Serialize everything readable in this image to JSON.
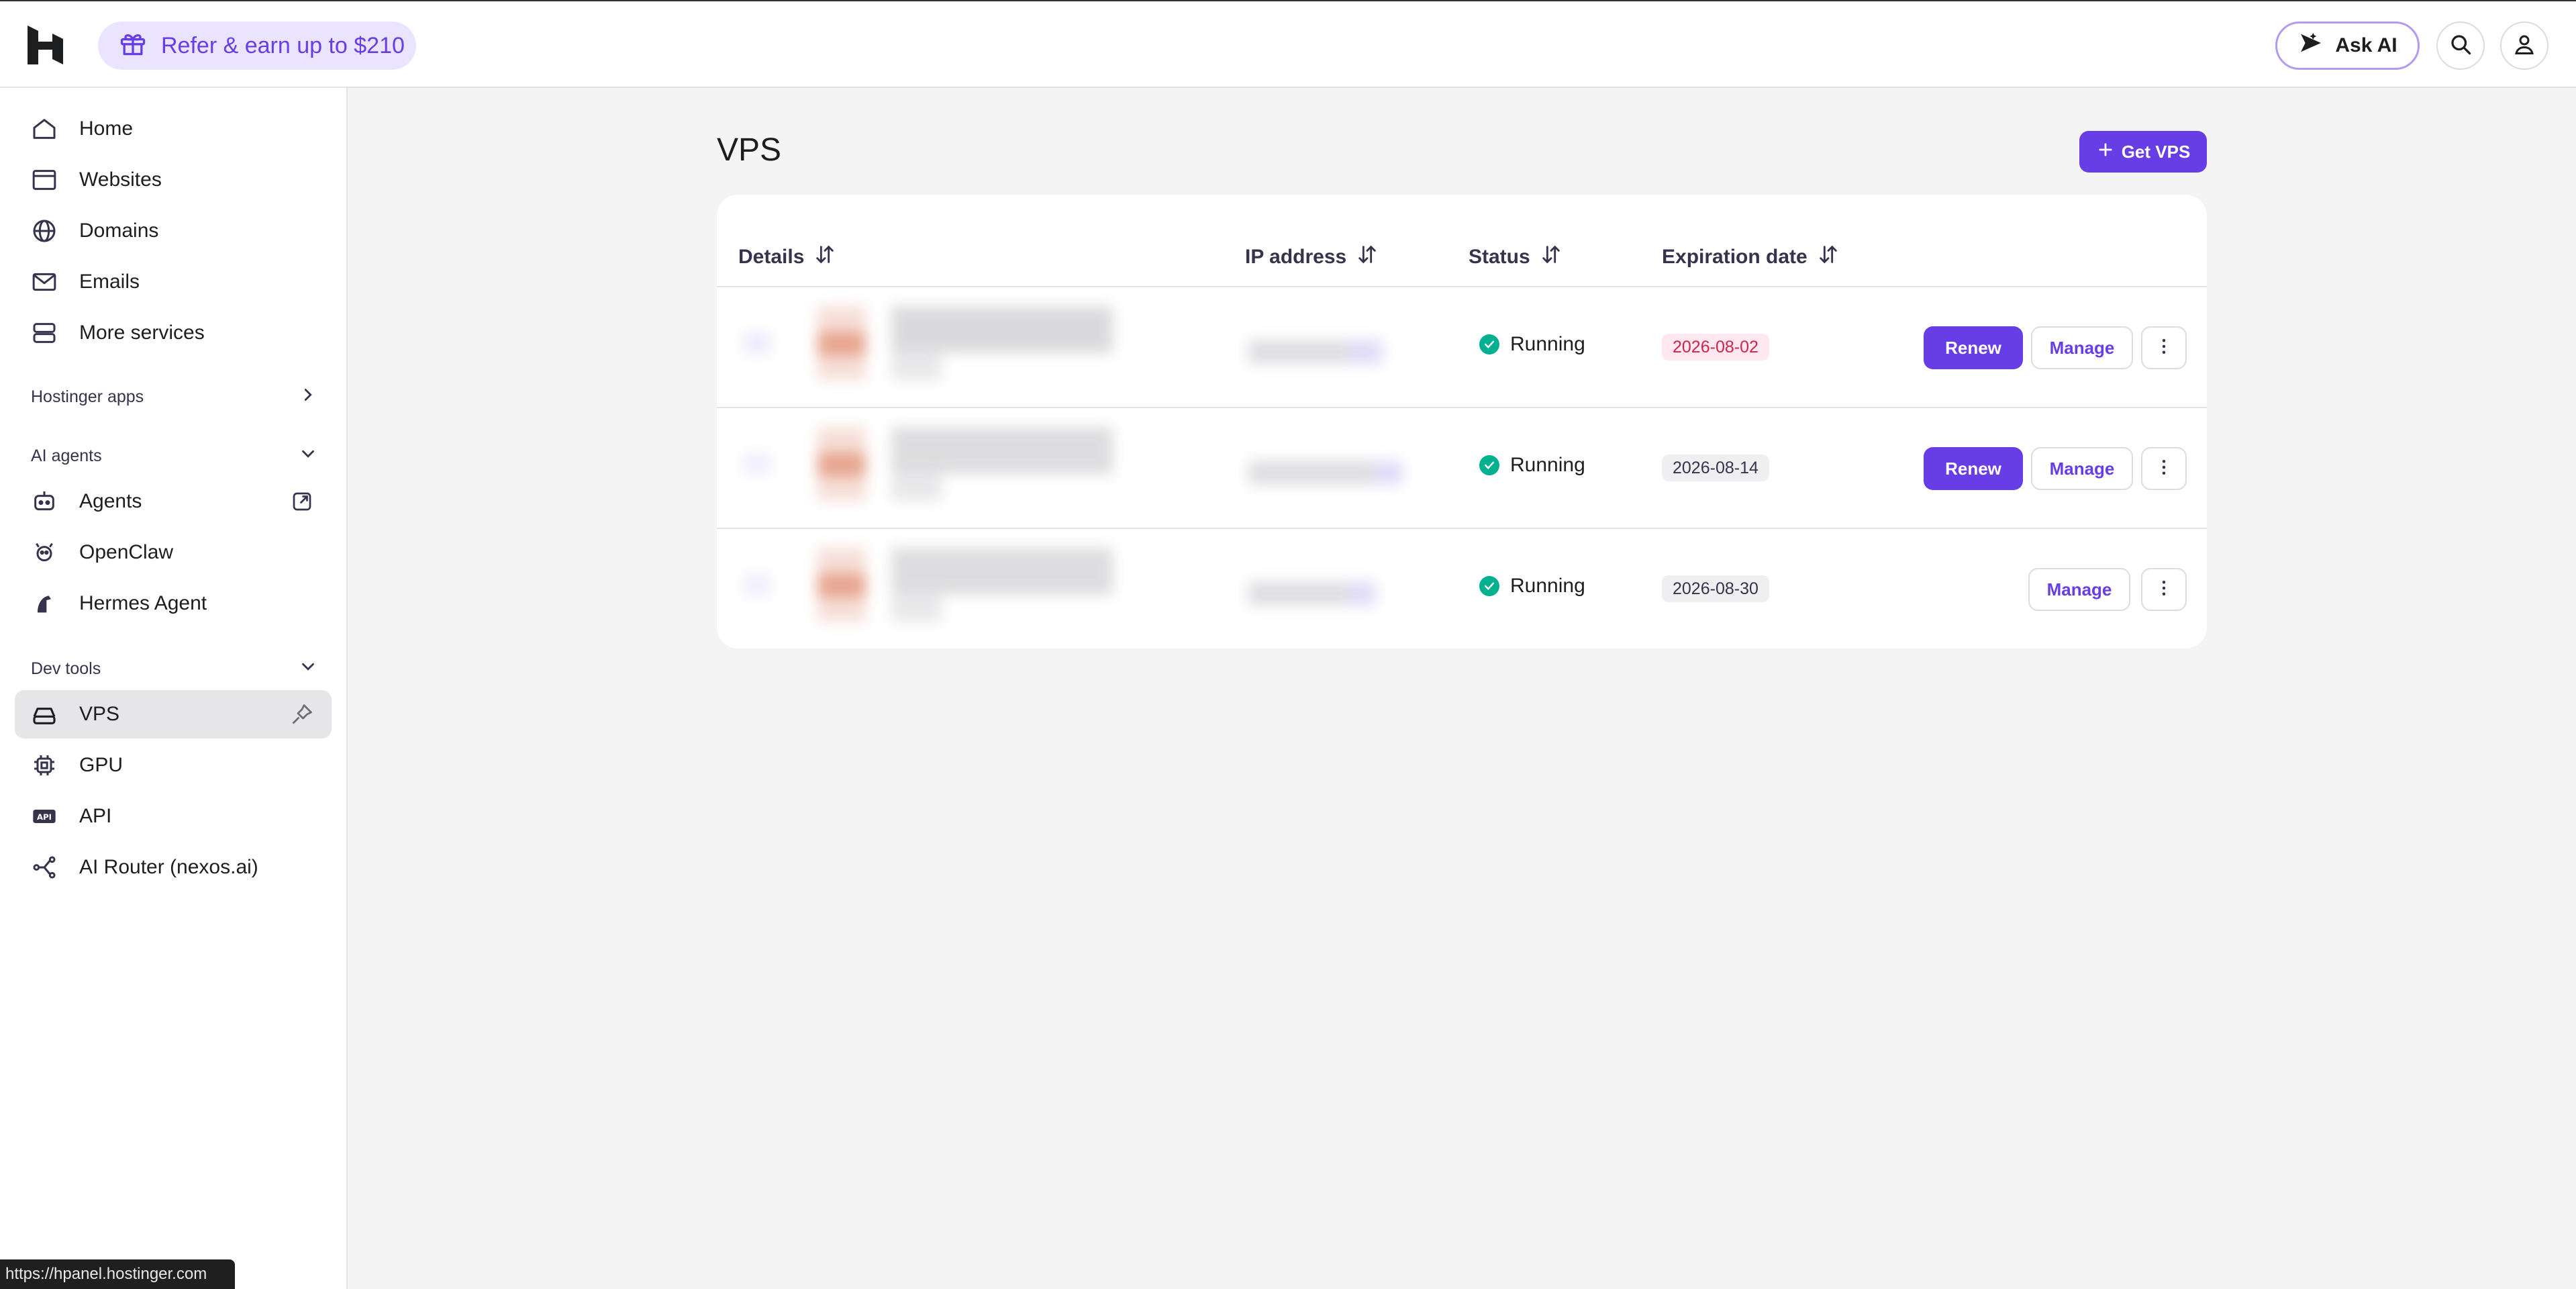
{
  "topbar": {
    "refer_label": "Refer & earn up to $210",
    "ask_ai_label": "Ask AI",
    "icons": [
      "hostinger-logo",
      "gift-icon",
      "ai-sparkle-icon",
      "search-icon",
      "user-icon"
    ]
  },
  "sidebar": {
    "primary": [
      {
        "label": "Home",
        "icon": "home-icon"
      },
      {
        "label": "Websites",
        "icon": "browser-icon"
      },
      {
        "label": "Domains",
        "icon": "globe-icon"
      },
      {
        "label": "Emails",
        "icon": "mail-icon"
      },
      {
        "label": "More services",
        "icon": "server-icon"
      }
    ],
    "hostinger_apps": "Hostinger apps",
    "ai_agents": {
      "title": "AI agents",
      "items": [
        {
          "label": "Agents",
          "icon": "agent-icon"
        },
        {
          "label": "OpenClaw",
          "icon": "claw-icon"
        },
        {
          "label": "Hermes Agent",
          "icon": "hermes-icon"
        }
      ]
    },
    "dev_tools": {
      "title": "Dev tools",
      "items": [
        {
          "label": "VPS",
          "icon": "vps-icon",
          "active": true
        },
        {
          "label": "GPU",
          "icon": "chip-icon"
        },
        {
          "label": "API",
          "icon": "api-icon"
        },
        {
          "label": "AI Router (nexos.ai)",
          "icon": "router-icon"
        }
      ]
    }
  },
  "main": {
    "title": "VPS",
    "get_vps_label": "Get VPS",
    "table": {
      "columns": [
        "Details",
        "IP address",
        "Status",
        "Expiration date"
      ],
      "rows": [
        {
          "status": "Running",
          "expiration": "2026-08-02",
          "expiring_soon": true,
          "renew": "Renew",
          "manage": "Manage"
        },
        {
          "status": "Running",
          "expiration": "2026-08-14",
          "expiring_soon": false,
          "renew": "Renew",
          "manage": "Manage"
        },
        {
          "status": "Running",
          "expiration": "2026-08-30",
          "expiring_soon": false,
          "manage": "Manage"
        }
      ]
    }
  },
  "status_bar": {
    "url": "https://hpanel.hostinger.com"
  },
  "colors": {
    "accent": "#673de6",
    "accent_soft": "#ebe4ff",
    "status_running": "#00b090",
    "warn_text": "#d1234a",
    "warn_bg": "#ffe8ef"
  }
}
